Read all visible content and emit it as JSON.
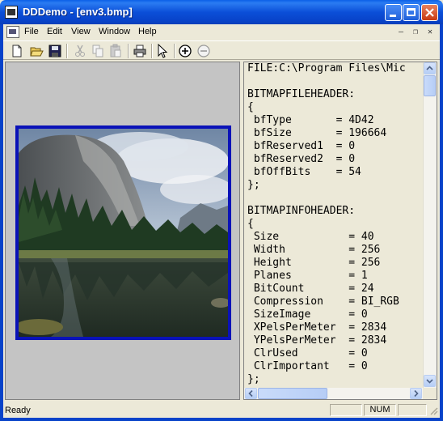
{
  "window": {
    "title": "DDDemo - [env3.bmp]"
  },
  "menu": {
    "items": [
      "File",
      "Edit",
      "View",
      "Window",
      "Help"
    ]
  },
  "toolbar": {
    "buttons": [
      "new-icon",
      "open-icon",
      "save-icon",
      "cut-icon",
      "copy-icon",
      "paste-icon",
      "print-icon",
      "pointer-icon",
      "zoom-in-icon",
      "zoom-out-icon"
    ]
  },
  "text_view": {
    "lines": [
      "FILE:C:\\Program Files\\Mic",
      "",
      "BITMAPFILEHEADER:",
      "{",
      " bfType       = 4D42",
      " bfSize       = 196664",
      " bfReserved1  = 0",
      " bfReserved2  = 0",
      " bfOffBits    = 54",
      "};",
      "",
      "BITMAPINFOHEADER:",
      "{",
      " Size           = 40",
      " Width          = 256",
      " Height         = 256",
      " Planes         = 1",
      " BitCount       = 24",
      " Compression    = BI_RGB",
      " SizeImage      = 0",
      " XPelsPerMeter  = 2834",
      " YPelsPerMeter  = 2834",
      " ClrUsed        = 0",
      " ClrImportant   = 0",
      "};"
    ]
  },
  "status": {
    "ready": "Ready",
    "num": "NUM"
  },
  "colors": {
    "titlebar": "#0843c9",
    "image_border": "#0a12b8",
    "pane_bg": "#c4c4c4",
    "face": "#ece9d8"
  }
}
